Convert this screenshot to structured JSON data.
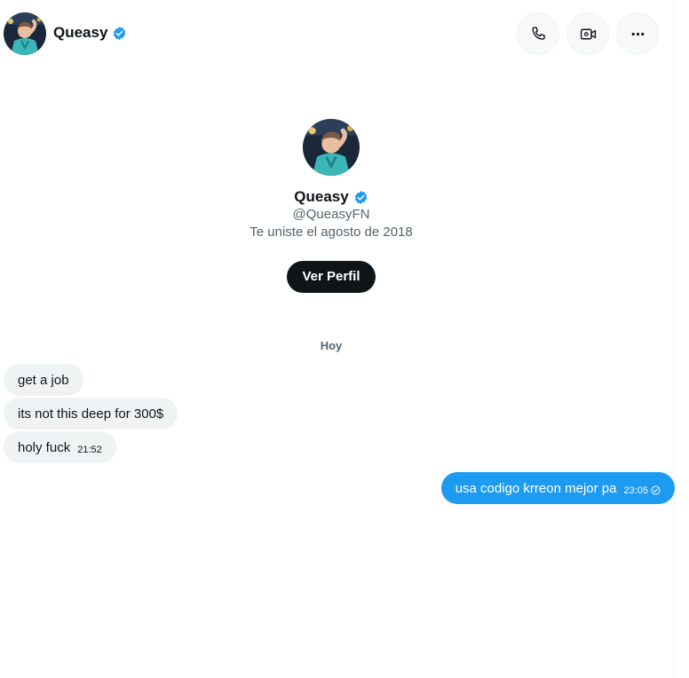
{
  "header": {
    "name": "Queasy"
  },
  "profile": {
    "name": "Queasy",
    "handle": "@QueasyFN",
    "joined": "Te uniste el agosto de 2018",
    "button": "Ver Perfil"
  },
  "day_divider": "Hoy",
  "messages": [
    {
      "text": "get a job",
      "direction": "incoming",
      "time": ""
    },
    {
      "text": "its not this deep for 300$",
      "direction": "incoming",
      "time": ""
    },
    {
      "text": "holy fuck",
      "direction": "incoming",
      "time": "21:52"
    },
    {
      "text": "usa codigo krreon mejor pa",
      "direction": "outgoing",
      "time": "23:05"
    }
  ],
  "icons": {
    "call": "phone-icon",
    "video": "video-icon",
    "more": "more-icon",
    "verified": "verified-badge-icon",
    "sent": "sent-check-icon"
  },
  "colors": {
    "accent": "#1d9bf0",
    "incoming_bubble": "#eff3f4",
    "button_dark": "#0f1419",
    "secondary_text": "#536471"
  }
}
